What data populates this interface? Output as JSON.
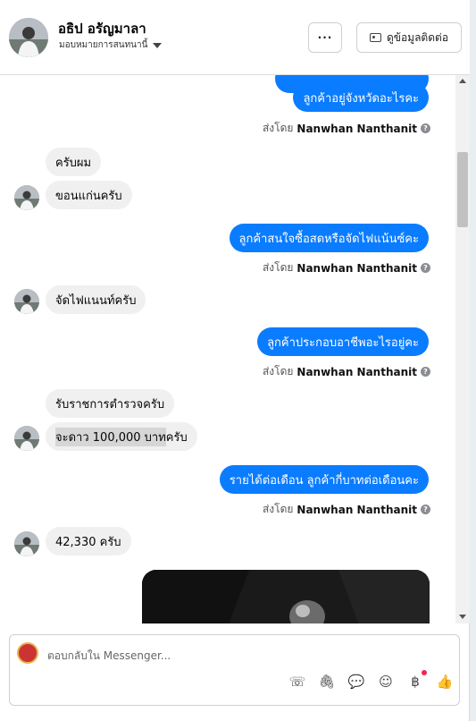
{
  "header": {
    "contact_name": "อธิป อรัญมาลา",
    "assign_label": "มอบหมายการสนทนานี้",
    "more_label": "···",
    "contact_info_label": "ดูข้อมูลติดต่อ"
  },
  "messages": [
    {
      "id": "m1",
      "dir": "out",
      "text": "ลูกค้าอยู่จังหวัดอะไรคะ"
    },
    {
      "id": "s1",
      "type": "sent_by",
      "prefix": "ส่งโดย",
      "agent": "Nanwhan Nanthanit"
    },
    {
      "id": "m2",
      "dir": "in",
      "text": "ครับผม"
    },
    {
      "id": "m3",
      "dir": "in",
      "text": "ขอนแก่นครับ"
    },
    {
      "id": "m4",
      "dir": "out",
      "text": "ลูกค้าสนใจซื้อสดหรือจัดไฟแน้นซ์คะ"
    },
    {
      "id": "s2",
      "type": "sent_by",
      "prefix": "ส่งโดย",
      "agent": "Nanwhan Nanthanit"
    },
    {
      "id": "m5",
      "dir": "in",
      "text": "จัดไฟแนนท์ครับ"
    },
    {
      "id": "m6",
      "dir": "out",
      "text": "ลูกค้าประกอบอาชีพอะไรอยู่คะ"
    },
    {
      "id": "s3",
      "type": "sent_by",
      "prefix": "ส่งโดย",
      "agent": "Nanwhan Nanthanit"
    },
    {
      "id": "m7",
      "dir": "in",
      "text": "รับราชการตำรวจครับ"
    },
    {
      "id": "m8",
      "dir": "in",
      "text_highlight": "จะดาว 100,000 บาท",
      "text": "ครับ"
    },
    {
      "id": "m9",
      "dir": "out",
      "text": "รายได้ต่อเดือน ลูกค้ากี่บาทต่อเดือนคะ"
    },
    {
      "id": "s4",
      "type": "sent_by",
      "prefix": "ส่งโดย",
      "agent": "Nanwhan Nanthanit"
    },
    {
      "id": "m10",
      "dir": "in",
      "text": "42,330 ครับ"
    }
  ],
  "composer": {
    "placeholder": "ตอบกลับใน Messenger..."
  },
  "tools": [
    {
      "name": "call-add-icon",
      "glyph": "☏"
    },
    {
      "name": "attachment-icon",
      "glyph": "🖇"
    },
    {
      "name": "saved-reply-icon",
      "glyph": "💬"
    },
    {
      "name": "emoji-icon",
      "glyph": "☺"
    },
    {
      "name": "payment-icon",
      "glyph": "฿"
    },
    {
      "name": "like-icon",
      "glyph": "👍"
    }
  ],
  "colors": {
    "outgoing_bubble": "#0a7cff",
    "incoming_bubble": "#f0f0f0"
  }
}
